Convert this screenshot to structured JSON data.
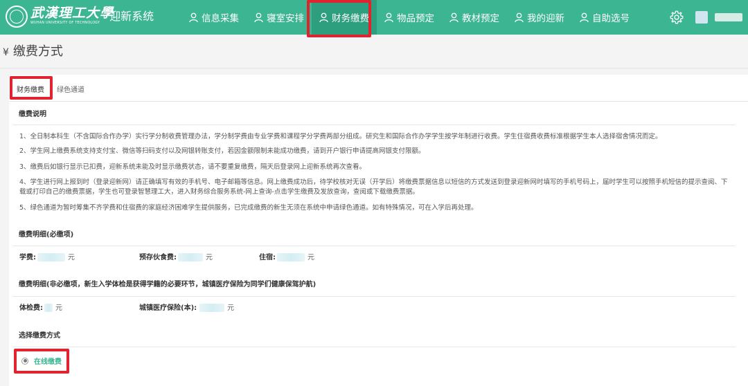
{
  "header": {
    "logo_cn": "武漢理工大學",
    "logo_en": "WUHAN UNIVERSITY OF TECHNOLOGY",
    "system_name": "· 迎新系统",
    "nav": [
      {
        "label": "信息采集",
        "icon": "user-icon",
        "active": false
      },
      {
        "label": "寝室安排",
        "icon": "user-icon",
        "active": false
      },
      {
        "label": "财务缴费",
        "icon": "user-icon",
        "active": true
      },
      {
        "label": "物品预定",
        "icon": "user-icon",
        "active": false
      },
      {
        "label": "教材预定",
        "icon": "user-icon",
        "active": false
      },
      {
        "label": "我的迎新",
        "icon": "user-icon",
        "active": false
      },
      {
        "label": "自助选号",
        "icon": "user-icon",
        "active": false
      }
    ],
    "settings_icon": "gear-icon"
  },
  "page": {
    "currency_symbol": "¥",
    "title": "缴费方式"
  },
  "tabs": [
    {
      "label": "财务缴费",
      "active": true
    },
    {
      "label": "绿色通道",
      "active": false
    }
  ],
  "instructions": {
    "title": "缴费说明",
    "items": [
      "1、全日制本科生（不含国际合作办学）实行学分制收费管理办法，学分制学费由专业学费和课程学分学费两部分组成。研究生和国际合作办学学生按学年制进行收费。学生住宿费收费标准根据学生本人选择宿舍情况而定。",
      "2、学生网上缴费系统支持支付宝、微信等扫码支付以及网银转账支付，若因金额限制未能成功缴费，请到开户银行申请提高网银支付限额。",
      "3、缴费后如银行显示已扣费，迎新系统未能及时显示缴费状态，请不要重复缴费，隔天后登录网上迎新系统再次查看。",
      "4、学生进行网上报到时（登录迎新网）请正确填写有效的手机号、电子邮箱等信息。网上缴费成功后，待学校核对无误（开学后）将缴费票据信息以短信的方式发送到登录迎新网时填写的手机号码上，届时学生可以按照手机短信的提示查阅、下载或打印自己的缴费票据，学生也可登录智慧理工大，进入财务综合服务系统-网上查询-点击学生缴费及发放查询，查阅或下载缴费票据。",
      "5、绿色通道为暂时筹集不齐学费和住宿费的家庭经济困难学生提供服务，已完成缴费的新生无须在系统中申请绿色通道。如有特殊情况，可在入学后再处理。"
    ]
  },
  "required_fees": {
    "title": "缴费明细(必缴项)",
    "items": [
      {
        "label": "学费:",
        "unit": "元"
      },
      {
        "label": "预存伙食费:",
        "unit": "元"
      },
      {
        "label": "住宿:",
        "unit": "元"
      }
    ]
  },
  "optional_fees": {
    "title": "缴费明细(非必缴项，新生入学体检是获得学籍的必要环节，城镇医疗保险为同学们健康保驾护航)",
    "items": [
      {
        "label": "体检费:",
        "unit": "元"
      },
      {
        "label": "城镇医疗保险(本):",
        "unit": "元"
      }
    ]
  },
  "payment_method": {
    "title": "选择缴费方式",
    "option": "在线缴费",
    "selected": true
  },
  "colors": {
    "brand": "#3bb592",
    "highlight": "#e0242f"
  }
}
